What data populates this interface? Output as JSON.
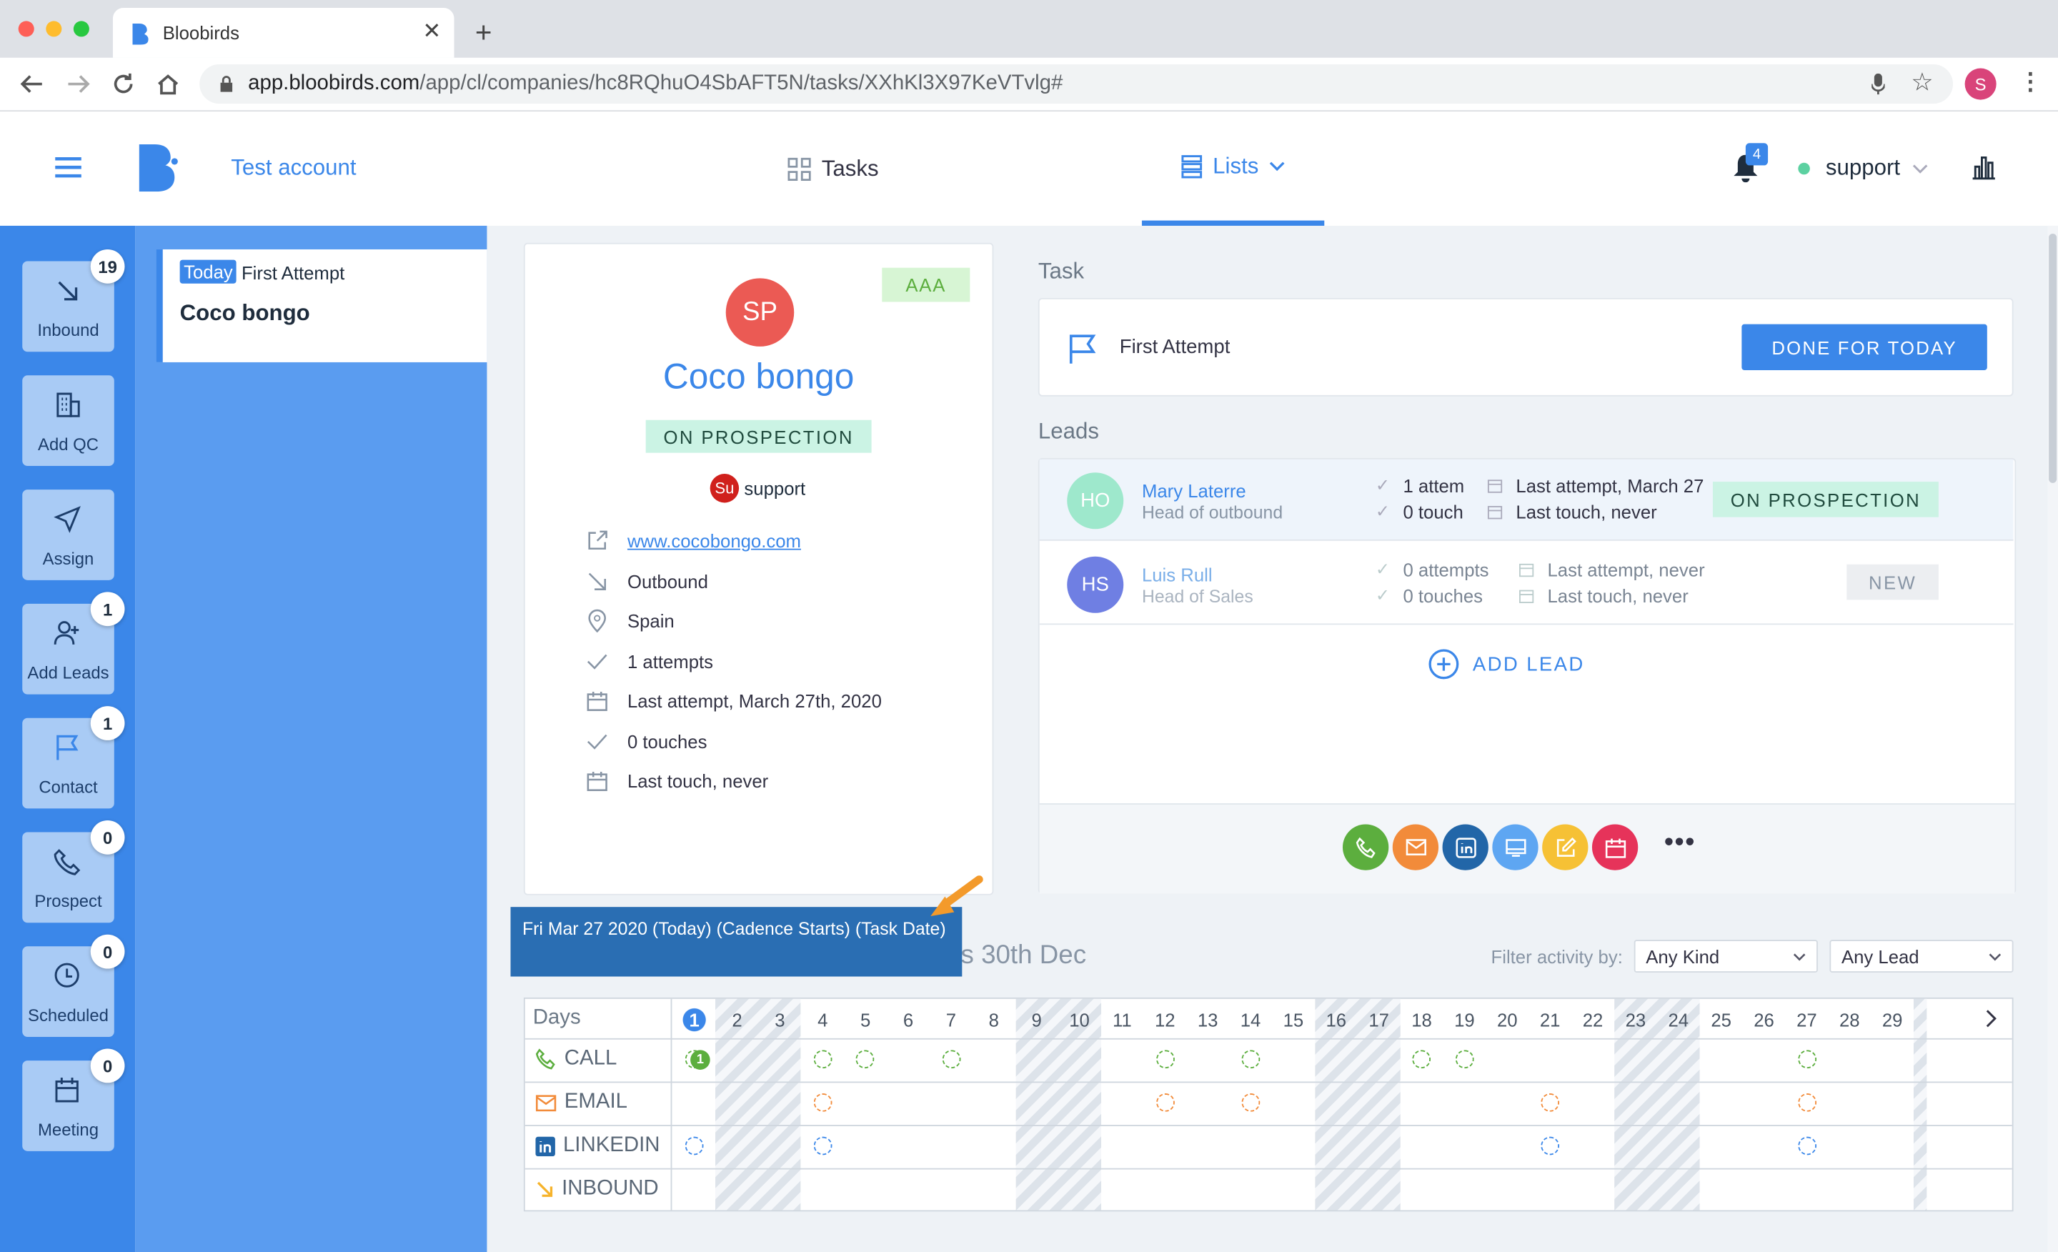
{
  "browser": {
    "tab_title": "Bloobirds",
    "url_host": "app.bloobirds.com",
    "url_path": "/app/cl/companies/hc8RQhuO4SbAFT5N/tasks/XXhKl3X97KeVTvlg#",
    "profile_initial": "S"
  },
  "header": {
    "account": "Test account",
    "tabs": {
      "tasks": "Tasks",
      "lists": "Lists"
    },
    "notifications": "4",
    "user": "support"
  },
  "rail": [
    {
      "label": "Inbound",
      "count": "19",
      "icon": "arrow-down-right-icon"
    },
    {
      "label": "Add QC",
      "count": "",
      "icon": "building-icon"
    },
    {
      "label": "Assign",
      "count": "",
      "icon": "send-icon"
    },
    {
      "label": "Add Leads",
      "count": "1",
      "icon": "user-plus-icon"
    },
    {
      "label": "Contact",
      "count": "1",
      "icon": "flag-icon"
    },
    {
      "label": "Prospect",
      "count": "0",
      "icon": "phone-icon"
    },
    {
      "label": "Scheduled",
      "count": "0",
      "icon": "clock-icon"
    },
    {
      "label": "Meeting",
      "count": "0",
      "icon": "calendar-icon"
    }
  ],
  "queue": {
    "tag": "Today",
    "task": "First Attempt",
    "company": "Coco bongo"
  },
  "company": {
    "initials": "SP",
    "name": "Coco bongo",
    "rating": "AAA",
    "status": "ON PROSPECTION",
    "owner_initials": "Su",
    "owner": "support",
    "website": "www.cocobongo.com",
    "source": "Outbound",
    "country": "Spain",
    "attempts": "1 attempts",
    "last_attempt": "Last attempt, March 27th, 2020",
    "touches": "0 touches",
    "last_touch": "Last touch, never"
  },
  "task": {
    "section": "Task",
    "name": "First Attempt",
    "button": "DONE FOR TODAY"
  },
  "leads": {
    "section": "Leads",
    "add": "ADD LEAD",
    "items": [
      {
        "initials": "HO",
        "name": "Mary Laterre",
        "title": "Head of outbound",
        "attempts": "1 attem",
        "touches": "0 touch",
        "last_attempt": "Last attempt, March 27",
        "last_touch": "Last touch, never",
        "status": "ON PROSPECTION"
      },
      {
        "initials": "HS",
        "name": "Luis Rull",
        "title": "Head of Sales",
        "attempts": "0 attempts",
        "touches": "0 touches",
        "last_attempt": "Last attempt, never",
        "last_touch": "Last touch, never",
        "status": "NEW"
      }
    ]
  },
  "actions": [
    "phone-icon",
    "mail-icon",
    "linkedin-icon",
    "screen-icon",
    "edit-icon",
    "calendar-icon",
    "more-icon"
  ],
  "timeline": {
    "title_fragment": "s 30th Dec",
    "filter_label": "Filter activity by:",
    "kind": "Any Kind",
    "lead": "Any Lead",
    "days_label": "Days",
    "days": [
      "1",
      "2",
      "3",
      "4",
      "5",
      "6",
      "7",
      "8",
      "9",
      "10",
      "11",
      "12",
      "13",
      "14",
      "15",
      "16",
      "17",
      "18",
      "19",
      "20",
      "21",
      "22",
      "23",
      "24",
      "25",
      "26",
      "27",
      "28",
      "29"
    ],
    "rows": [
      "CALL",
      "EMAIL",
      "LINKEDIN",
      "INBOUND"
    ],
    "call_first_count": "1"
  },
  "tooltip": "Fri Mar 27 2020 (Today) (Cadence Starts) (Task Date)",
  "colors": {
    "primary": "#3b87e9",
    "green": "#5cbf5c",
    "orange": "#f28b3a",
    "blue": "#1877d4"
  }
}
